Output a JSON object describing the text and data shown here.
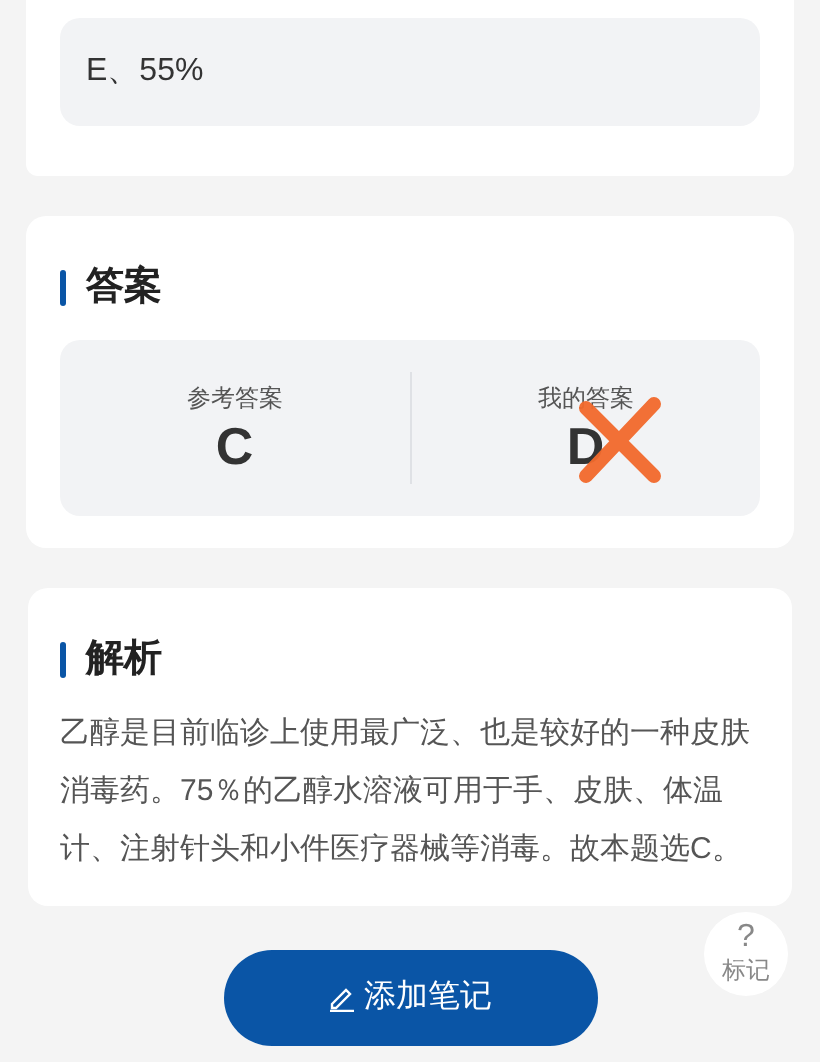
{
  "options": [
    {
      "label": "E、55%"
    }
  ],
  "answer": {
    "title": "答案",
    "reference_label": "参考答案",
    "reference": "C",
    "mine_label": "我的答案",
    "mine": "D",
    "mine_correct": false
  },
  "analysis": {
    "title": "解析",
    "text": "乙醇是目前临诊上使用最广泛、也是较好的一种皮肤消毒药。75％的乙醇水溶液可用于手、皮肤、体温计、注射针头和小件医疗器械等消毒。故本题选C。"
  },
  "mark_button": {
    "icon": "?",
    "label": "标记"
  },
  "add_note_button": {
    "label": "添加笔记"
  }
}
